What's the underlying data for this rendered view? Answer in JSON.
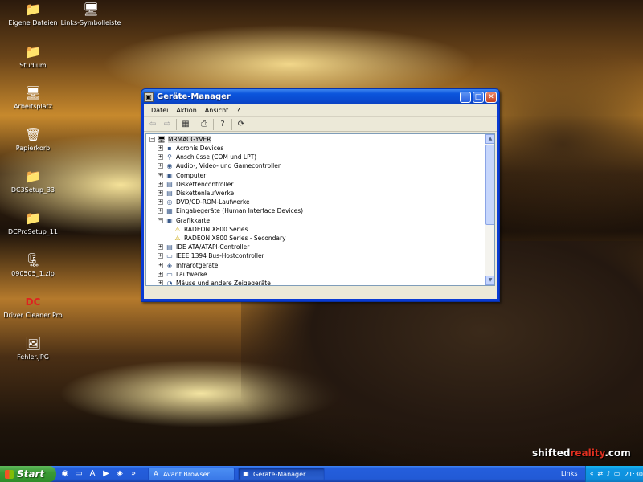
{
  "desktop": {
    "icons": [
      {
        "label": "Eigene Dateien",
        "icon": "my-documents-icon",
        "glyph": "📁"
      },
      {
        "label": "Links-Symbolleiste",
        "icon": "links-toolbar-icon",
        "glyph": "🖥"
      },
      {
        "label": "Studium",
        "icon": "shortcut-folder-icon",
        "glyph": "📁"
      },
      {
        "label": "Arbeitsplatz",
        "icon": "my-computer-icon",
        "glyph": "🖥"
      },
      {
        "label": "Papierkorb",
        "icon": "recycle-bin-icon",
        "glyph": "🗑"
      },
      {
        "label": "DC3Setup_33",
        "icon": "folder-icon",
        "glyph": "📁"
      },
      {
        "label": "DCProSetup_11",
        "icon": "folder-icon",
        "glyph": "📁"
      },
      {
        "label": "090505_1.zip",
        "icon": "zip-archive-icon",
        "glyph": "🗜"
      },
      {
        "label": "Driver Cleaner Pro",
        "icon": "driver-cleaner-icon",
        "glyph": "DC"
      },
      {
        "label": "Fehler.JPG",
        "icon": "image-file-icon",
        "glyph": "🖼"
      }
    ],
    "watermark": {
      "part1": "shifted",
      "part2": "reality",
      "part3": ".com"
    }
  },
  "window": {
    "title": "Geräte-Manager",
    "buttons": {
      "minimize": "_",
      "maximize": "□",
      "close": "✕"
    },
    "menu": [
      "Datei",
      "Aktion",
      "Ansicht",
      "?"
    ],
    "toolbar": [
      "back-arrow-icon",
      "forward-arrow-icon",
      "properties-icon",
      "print-icon",
      "help-icon",
      "scan-hardware-icon"
    ],
    "tree": {
      "root": "MRMACGYVER",
      "items": [
        {
          "label": "Acronis Devices",
          "expander": "+",
          "icon": "▪",
          "indent": 1
        },
        {
          "label": "Anschlüsse (COM und LPT)",
          "expander": "+",
          "icon": "⚲",
          "indent": 1
        },
        {
          "label": "Audio-, Video- und Gamecontroller",
          "expander": "+",
          "icon": "◉",
          "indent": 1
        },
        {
          "label": "Computer",
          "expander": "+",
          "icon": "▣",
          "indent": 1
        },
        {
          "label": "Diskettencontroller",
          "expander": "+",
          "icon": "▤",
          "indent": 1
        },
        {
          "label": "Diskettenlaufwerke",
          "expander": "+",
          "icon": "▤",
          "indent": 1
        },
        {
          "label": "DVD/CD-ROM-Laufwerke",
          "expander": "+",
          "icon": "◎",
          "indent": 1
        },
        {
          "label": "Eingabegeräte (Human Interface Devices)",
          "expander": "+",
          "icon": "▦",
          "indent": 1
        },
        {
          "label": "Grafikkarte",
          "expander": "−",
          "icon": "▣",
          "indent": 1
        },
        {
          "label": "RADEON X800 Series",
          "expander": "",
          "icon": "⚠",
          "indent": 2
        },
        {
          "label": "RADEON X800 Series - Secondary",
          "expander": "",
          "icon": "⚠",
          "indent": 2
        },
        {
          "label": "IDE ATA/ATAPI-Controller",
          "expander": "+",
          "icon": "▤",
          "indent": 1
        },
        {
          "label": "IEEE 1394 Bus-Hostcontroller",
          "expander": "+",
          "icon": "▭",
          "indent": 1
        },
        {
          "label": "Infrarotgeräte",
          "expander": "+",
          "icon": "◈",
          "indent": 1
        },
        {
          "label": "Laufwerke",
          "expander": "+",
          "icon": "▭",
          "indent": 1
        },
        {
          "label": "Mäuse und andere Zeigegeräte",
          "expander": "+",
          "icon": "◔",
          "indent": 1
        }
      ]
    }
  },
  "taskbar": {
    "start_label": "Start",
    "tasks": [
      {
        "label": "Avant Browser",
        "icon": "avant-browser-icon",
        "glyph": "A",
        "active": false
      },
      {
        "label": "Geräte-Manager",
        "icon": "device-manager-icon",
        "glyph": "▣",
        "active": true
      }
    ],
    "links_label": "Links",
    "clock": "21:30"
  }
}
